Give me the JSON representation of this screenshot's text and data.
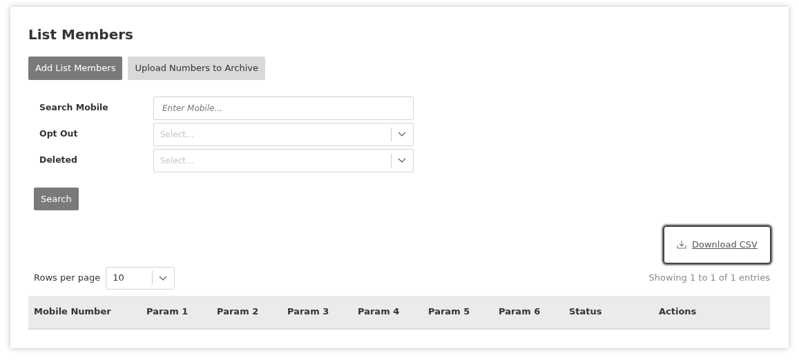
{
  "title": "List Members",
  "buttons": [
    {
      "label": "Add List Members",
      "kind": "primary"
    },
    {
      "label": "Upload Numbers to Archive",
      "kind": "secondary"
    }
  ],
  "filters": [
    {
      "label": "Search Mobile",
      "kind": "text",
      "placeholder": "Enter Mobile..."
    },
    {
      "label": "Opt Out",
      "kind": "select",
      "placeholder": "Select..."
    },
    {
      "label": "Deleted",
      "kind": "select",
      "placeholder": "Select..."
    }
  ],
  "search_button": "Search",
  "download": {
    "label": "Download CSV"
  },
  "rows_per_page": {
    "label": "Rows per page",
    "value": "10"
  },
  "showing": "Showing 1 to 1 of 1 entries",
  "table": {
    "columns": [
      "Mobile Number",
      "Param 1",
      "Param 2",
      "Param 3",
      "Param 4",
      "Param 5",
      "Param 6",
      "Status",
      "Actions"
    ]
  }
}
